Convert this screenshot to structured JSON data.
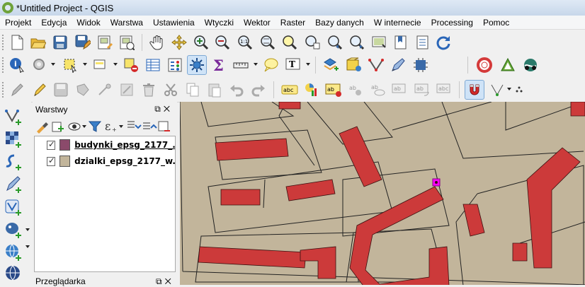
{
  "window": {
    "title": "*Untitled Project - QGIS"
  },
  "menu": [
    "Projekt",
    "Edycja",
    "Widok",
    "Warstwa",
    "Ustawienia",
    "Wtyczki",
    "Wektor",
    "Raster",
    "Bazy danych",
    "W internecie",
    "Processing",
    "Pomoc"
  ],
  "toolbar3": {
    "snapping_tolerance": "12"
  },
  "layers_panel": {
    "title": "Warstwy",
    "layers": [
      {
        "name": "budynki_epsg_2177_...",
        "checked": true,
        "color": "#8b4a6b"
      },
      {
        "name": "dzialki_epsg_2177_w...",
        "checked": true,
        "color": "#c2b59b"
      }
    ]
  },
  "browser_panel": {
    "title": "Przeglądarka"
  },
  "colors": {
    "parcel_fill": "#c2b59b",
    "building_fill": "#cc3a3a",
    "selection": "#ff00ff"
  }
}
